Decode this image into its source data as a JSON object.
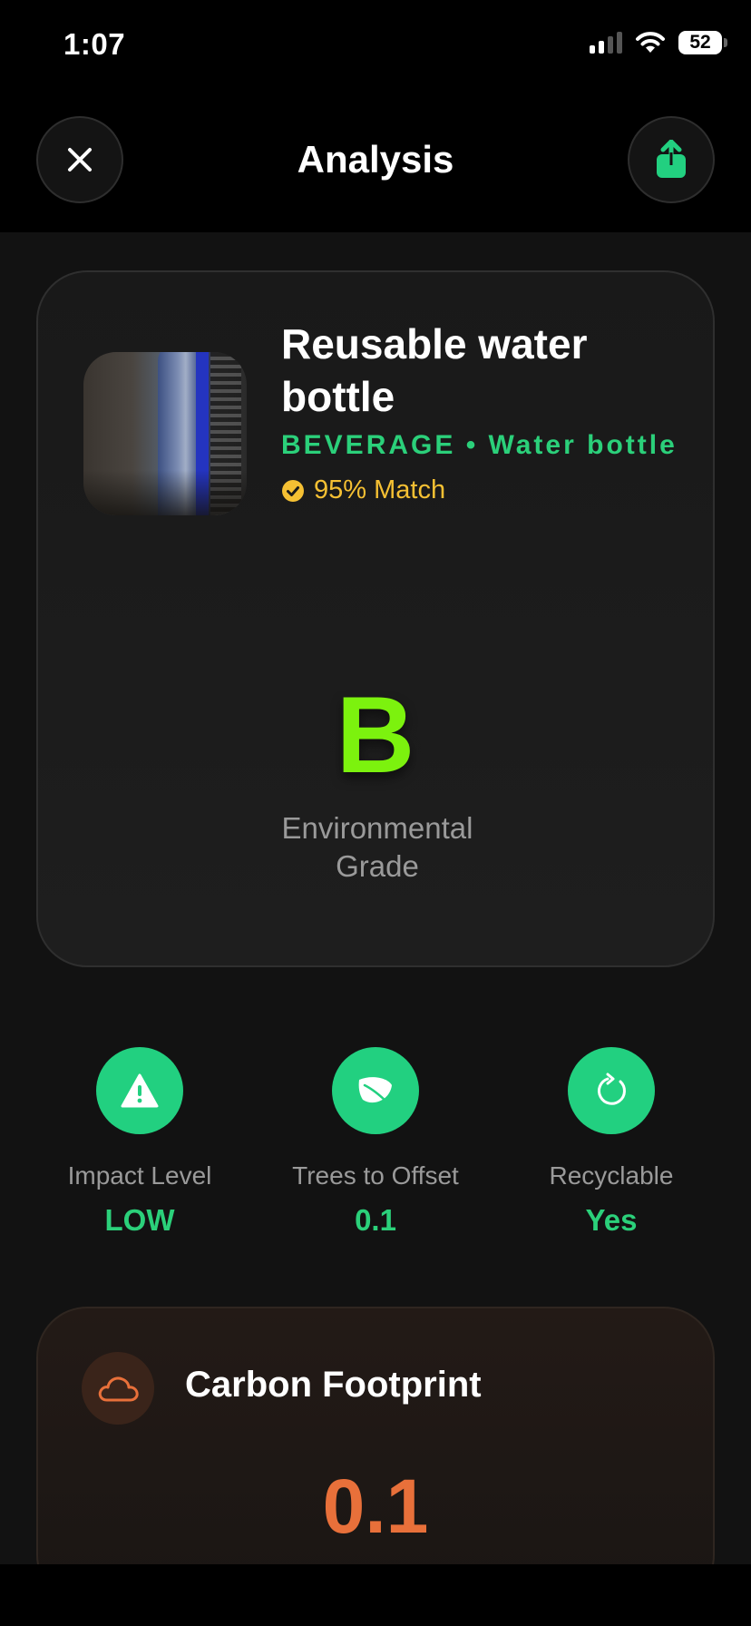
{
  "status_bar": {
    "time": "1:07",
    "battery": "52"
  },
  "nav": {
    "title": "Analysis"
  },
  "product": {
    "name": "Reusable water bottle",
    "category": "BEVERAGE • Water bottle",
    "match": "95% Match",
    "grade": "B",
    "grade_label": "Environmental Grade"
  },
  "stats": [
    {
      "label": "Impact Level",
      "value": "LOW",
      "icon": "warning-icon"
    },
    {
      "label": "Trees to Offset",
      "value": "0.1",
      "icon": "leaf-icon"
    },
    {
      "label": "Recyclable",
      "value": "Yes",
      "icon": "recycle-icon"
    }
  ],
  "carbon": {
    "title": "Carbon Footprint",
    "value": "0.1",
    "icon": "cloud-icon"
  },
  "colors": {
    "accent_green": "#22d080",
    "grade_green": "#7cf20e",
    "match_yellow": "#f5c033",
    "carbon_orange": "#e8703a"
  }
}
